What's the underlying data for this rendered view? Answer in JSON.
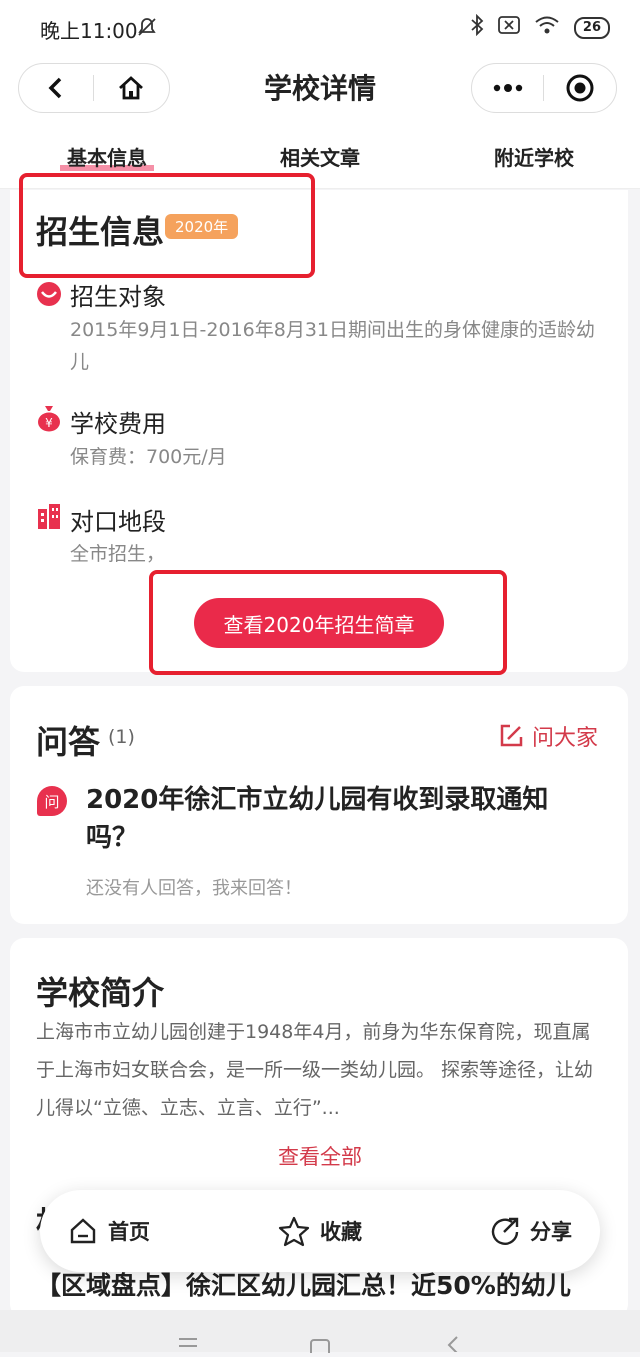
{
  "status_bar": {
    "time": "晚上11:00",
    "battery": "26"
  },
  "nav": {
    "title": "学校详情"
  },
  "tabs": [
    {
      "label": "基本信息",
      "active": true
    },
    {
      "label": "相关文章",
      "active": false
    },
    {
      "label": "附近学校",
      "active": false
    }
  ],
  "admission": {
    "heading": "招生信息",
    "year_badge": "2020年",
    "items": [
      {
        "title": "招生对象",
        "text": "2015年9月1日-2016年8月31日期间出生的身体健康的适龄幼儿",
        "icon": "smile-icon"
      },
      {
        "title": "学校费用",
        "text": "保育费：700元/月",
        "icon": "money-bag-icon"
      },
      {
        "title": "对口地段",
        "text": "全市招生，",
        "icon": "building-icon"
      }
    ],
    "cta_label": "查看2020年招生简章"
  },
  "qa": {
    "heading": "问答",
    "count": "(1)",
    "ask_label": "问大家",
    "badge": "问",
    "question": "2020年徐汇市立幼儿园有收到录取通知吗？",
    "answer_prompt": "还没有人回答，我来回答！"
  },
  "intro": {
    "heading": "学校简介",
    "text": "上海市市立幼儿园创建于1948年4月，前身为华东保育院，现直属于上海市妇女联合会，是一所一级一类幼儿园。 探索等途径，让幼儿得以“立德、立志、立言、立行”...",
    "more_label": "查看全部"
  },
  "article_peek": {
    "title": "【区域盘点】徐汇区幼儿园汇总！近50%的幼儿"
  },
  "bottom_bar": {
    "home": "首页",
    "favorite": "收藏",
    "share": "分享"
  },
  "colors": {
    "accent": "#ea2a4a",
    "badge": "#f5a25d",
    "annotation": "#e6202f"
  }
}
